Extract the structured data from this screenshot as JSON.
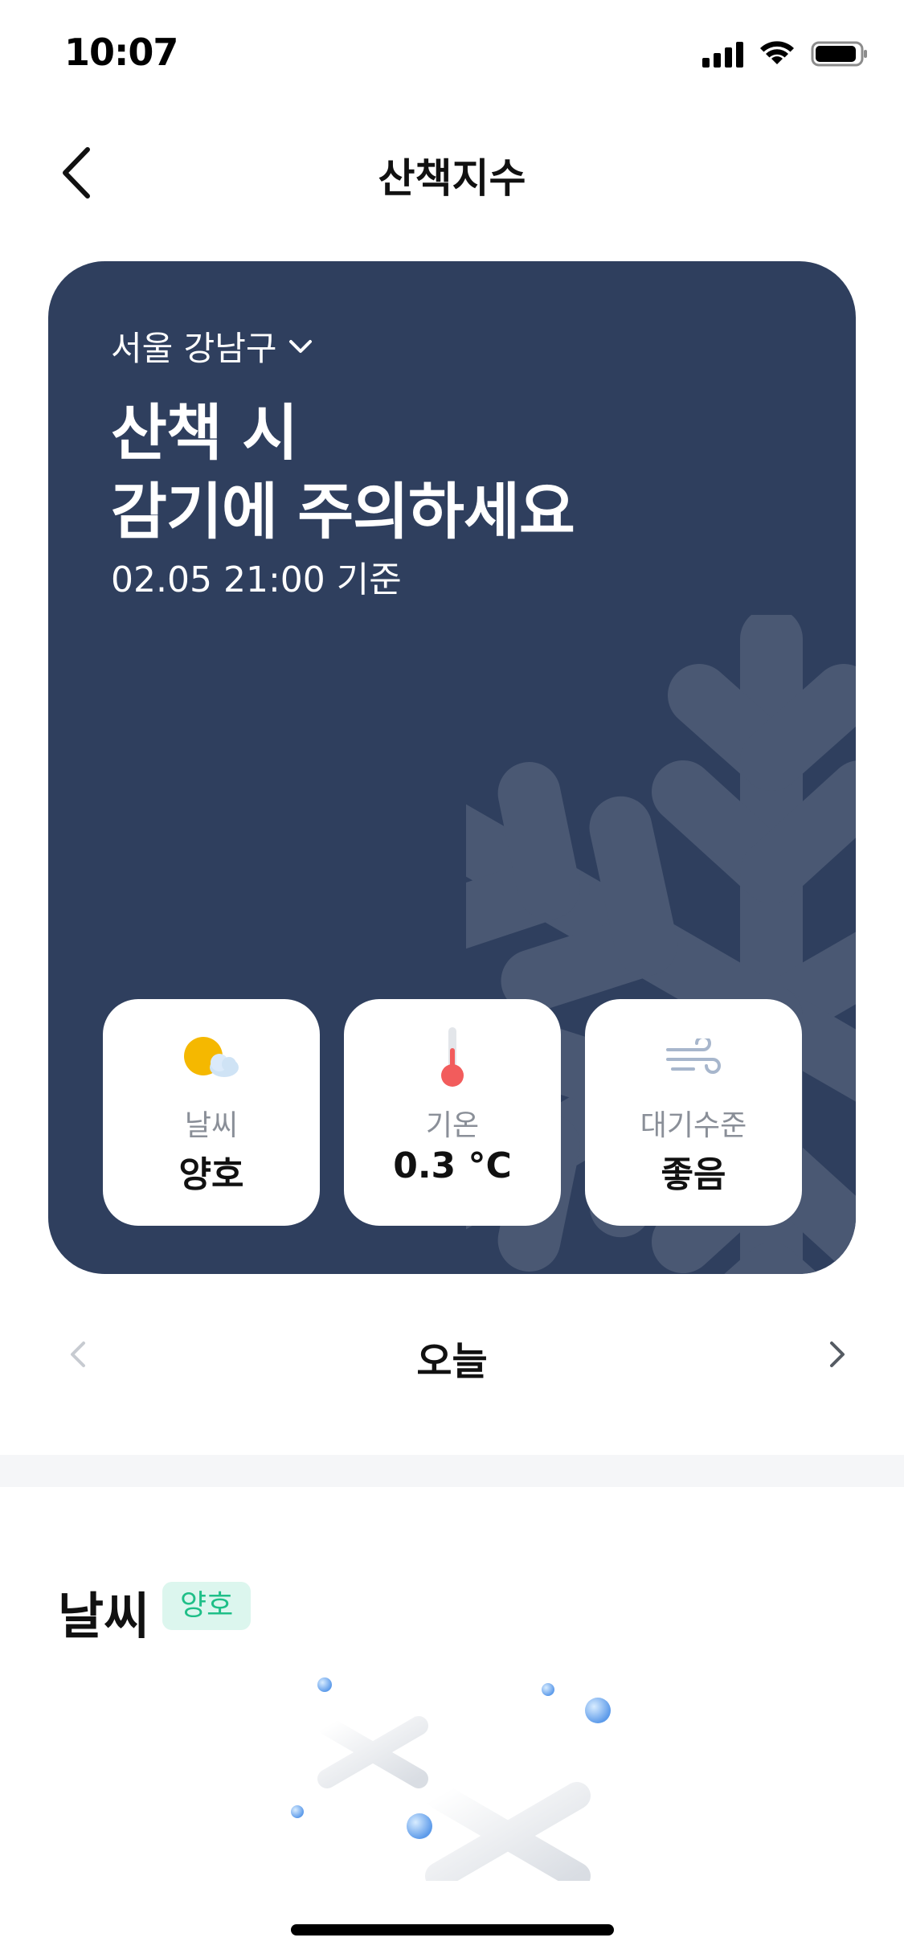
{
  "status_bar": {
    "time": "10:07"
  },
  "nav": {
    "title": "산책지수"
  },
  "hero": {
    "location": "서울 강남구",
    "headline_line1": "산책 시",
    "headline_line2": "감기에 주의하세요",
    "timestamp": "02.05 21:00 기준",
    "background_color": "#2f3f5e"
  },
  "metrics": [
    {
      "icon": "sun-cloud-icon",
      "label": "날씨",
      "value": "양호"
    },
    {
      "icon": "thermometer-icon",
      "label": "기온",
      "value": "0.3 °C"
    },
    {
      "icon": "wind-icon",
      "label": "대기수준",
      "value": "좋음"
    }
  ],
  "day_switcher": {
    "label": "오늘"
  },
  "weather_section": {
    "title": "날씨",
    "badge": "양호",
    "badge_color": "#1fbf88"
  }
}
